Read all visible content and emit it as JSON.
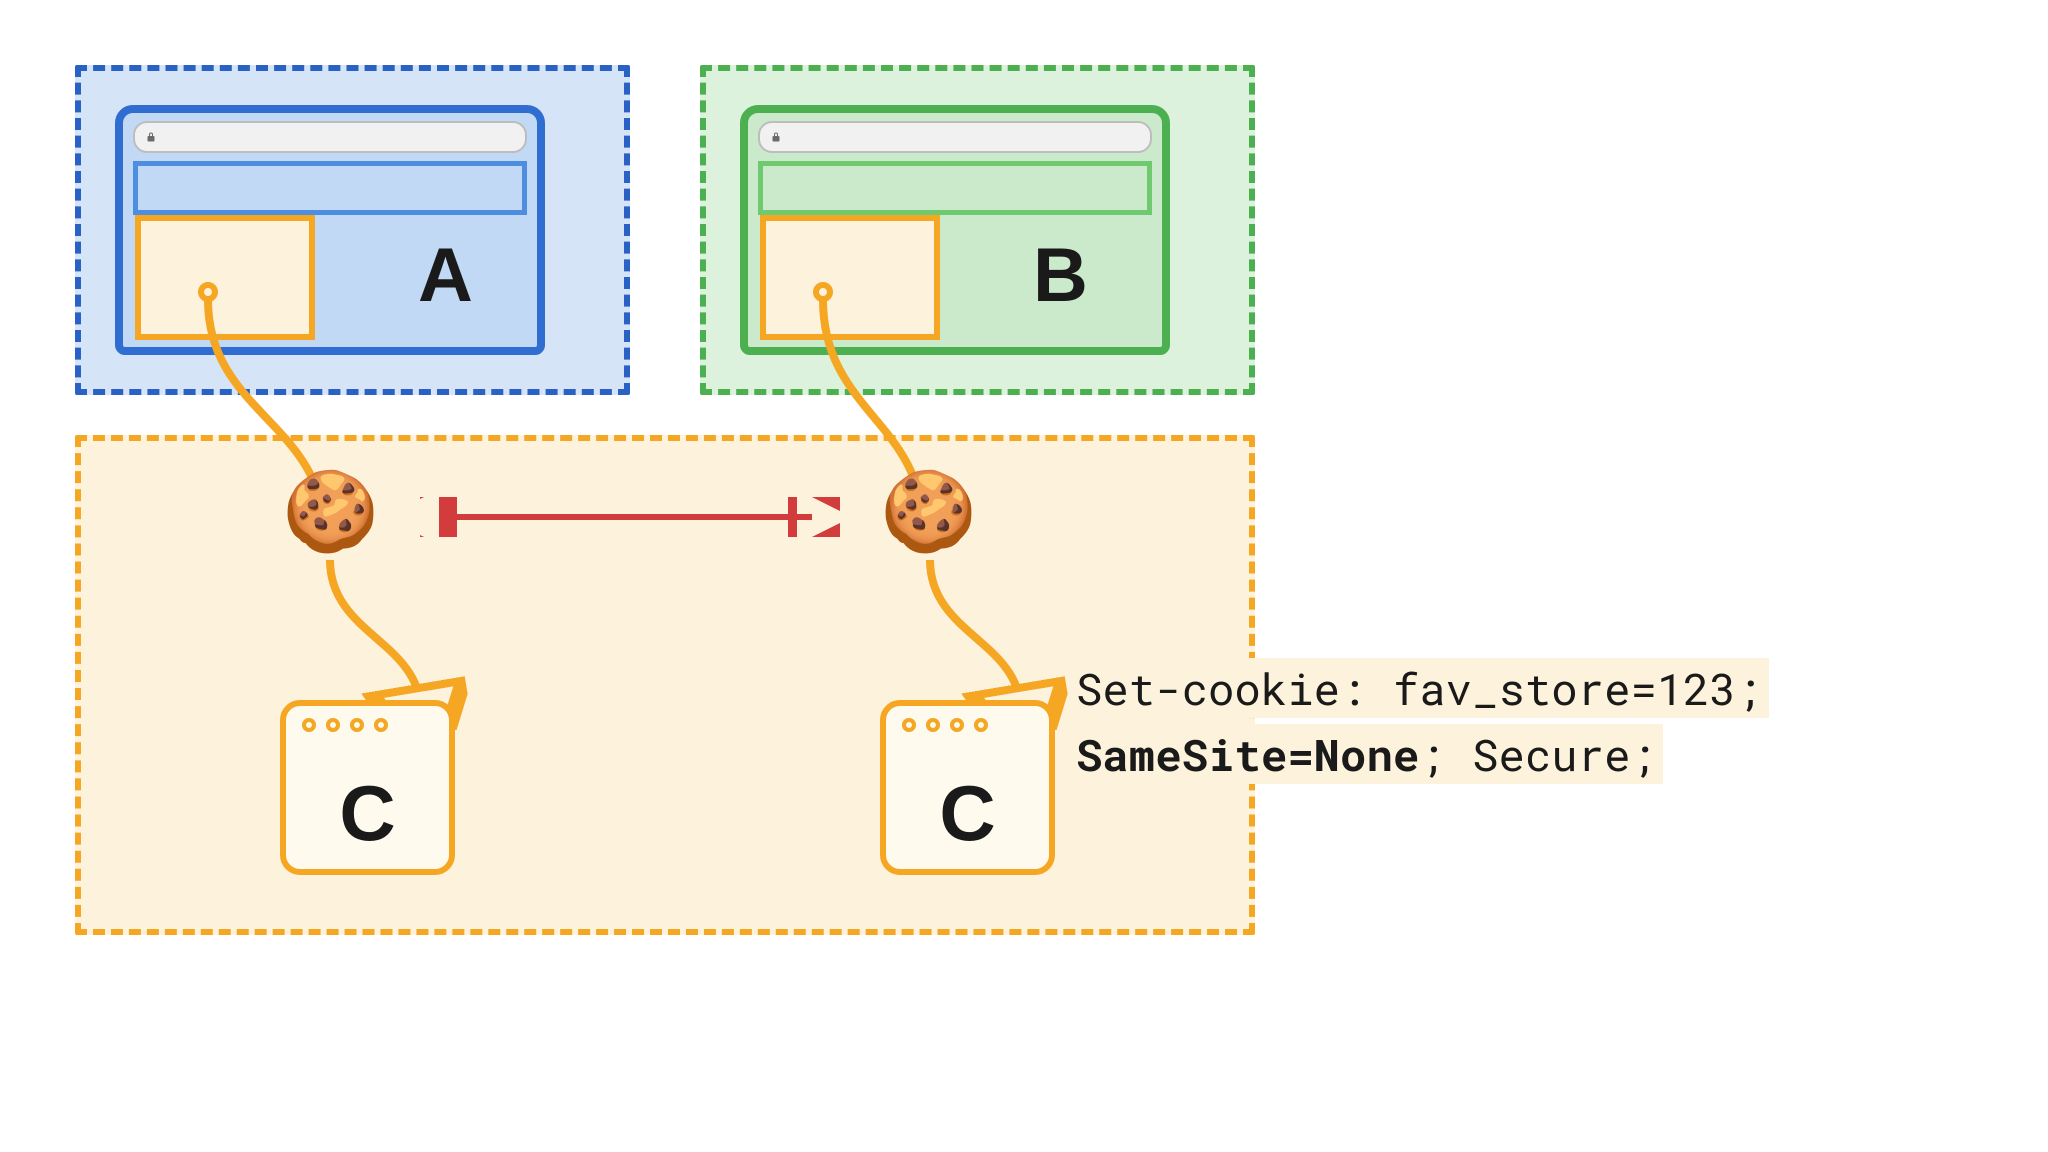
{
  "origins": {
    "a": {
      "label": "A",
      "color": "#2962c4"
    },
    "b": {
      "label": "B",
      "color": "#4caf50"
    },
    "c": {
      "color": "#f5a623"
    }
  },
  "targets": {
    "c1": {
      "label": "C"
    },
    "c2": {
      "label": "C"
    }
  },
  "cookie_icon": "🍪",
  "code": {
    "line1": "Set-cookie: fav_store=123;",
    "line2_bold": "SameSite=None",
    "line2_rest": "; Secure;"
  }
}
